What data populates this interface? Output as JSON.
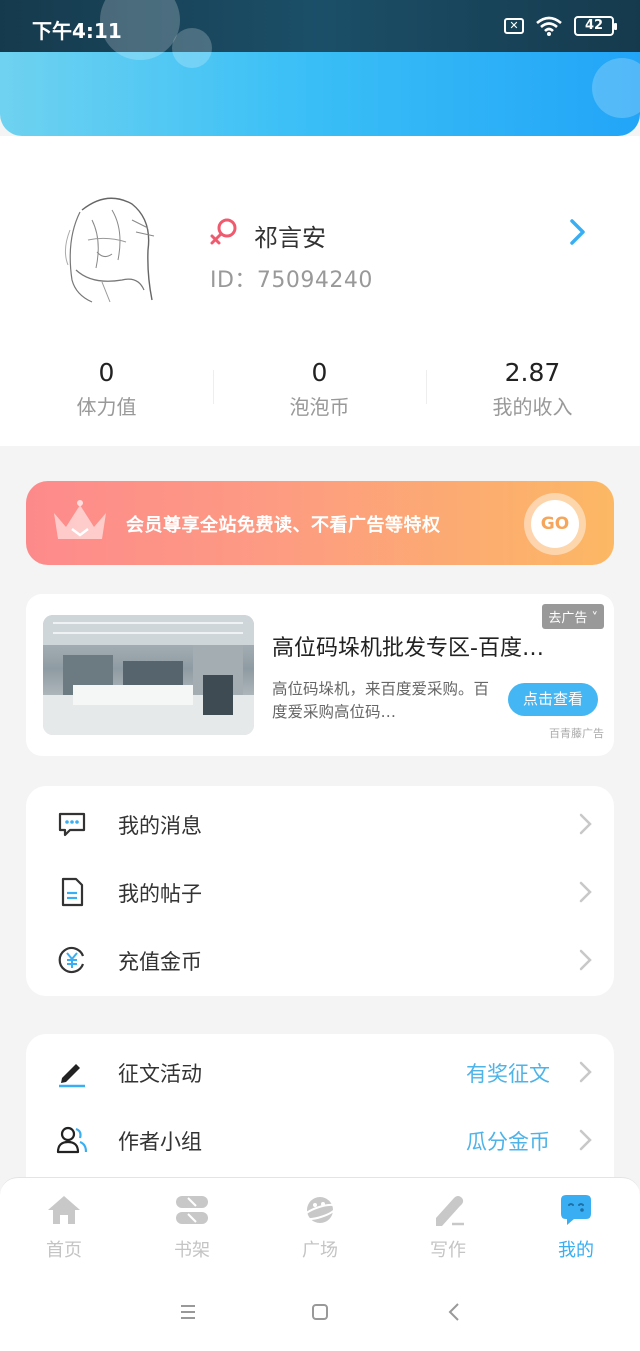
{
  "status_bar": {
    "time": "下午4:11",
    "battery": "42"
  },
  "profile": {
    "username": "祁言安",
    "user_id": "ID：75094240",
    "stats": [
      {
        "value": "0",
        "label": "体力值"
      },
      {
        "value": "0",
        "label": "泡泡币"
      },
      {
        "value": "2.87",
        "label": "我的收入"
      }
    ]
  },
  "vip": {
    "text": "会员尊享全站免费读、不看广告等特权",
    "go_label": "GO"
  },
  "ad": {
    "close_label": "去广告 ˅",
    "title": "高位码垛机批发专区-百度…",
    "description": "高位码垛机，来百度爱采购。百度爱采购高位码…",
    "cta": "点击查看",
    "source": "百青藤广告"
  },
  "menu_primary": [
    {
      "label": "我的消息",
      "icon": "message-icon"
    },
    {
      "label": "我的帖子",
      "icon": "document-icon"
    },
    {
      "label": "充值金币",
      "icon": "yuan-coin-icon"
    }
  ],
  "menu_secondary": [
    {
      "label": "征文活动",
      "extra": "有奖征文",
      "icon": "pen-icon"
    },
    {
      "label": "作者小组",
      "extra": "瓜分金币",
      "icon": "group-icon"
    }
  ],
  "tabs": [
    {
      "label": "首页",
      "icon": "home-icon",
      "active": false
    },
    {
      "label": "书架",
      "icon": "bookshelf-icon",
      "active": false
    },
    {
      "label": "广场",
      "icon": "planet-icon",
      "active": false
    },
    {
      "label": "写作",
      "icon": "write-icon",
      "active": false
    },
    {
      "label": "我的",
      "icon": "me-chat-icon",
      "active": true
    }
  ],
  "colors": {
    "accent": "#3aaef2",
    "vip_start": "#fd8a8b",
    "vip_end": "#fcb864",
    "gender": "#f05a6e"
  }
}
